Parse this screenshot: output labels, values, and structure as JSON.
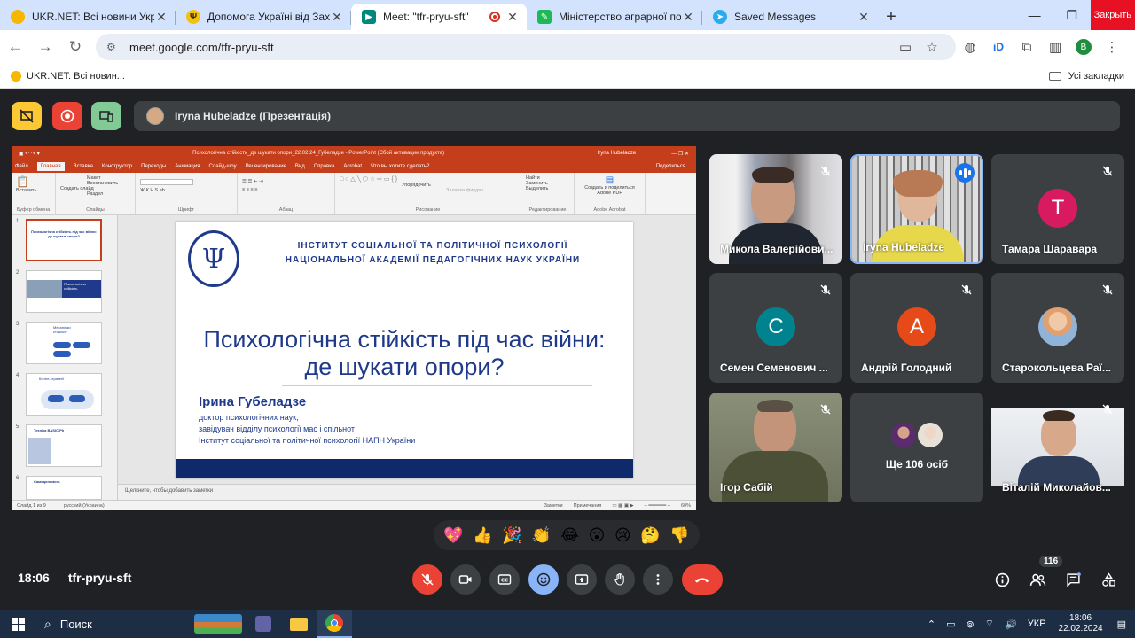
{
  "browser": {
    "tabs": [
      {
        "title": "UKR.NET: Всі новини України, о",
        "favicon_color": "#f5b700",
        "active": false
      },
      {
        "title": "Допомога Україні від Заходу с",
        "favicon_color": "#f4c20d",
        "active": false
      },
      {
        "title": "Meet: \"tfr-pryu-sft\"",
        "favicon_color": "#00897b",
        "active": true,
        "recording": true
      },
      {
        "title": "Міністерство аграрної політи",
        "favicon_color": "#1db954",
        "active": false
      },
      {
        "title": "Saved Messages",
        "favicon_color": "#2aabee",
        "active": false
      }
    ],
    "close_label": "Закрыть",
    "url": "meet.google.com/tfr-pryu-sft",
    "profile_letter": "В",
    "bookmark": "UKR.NET: Всі новин...",
    "all_bookmarks": "Усі закладки"
  },
  "meet": {
    "presenter_label": "Iryna Hubeladze (Презентація)",
    "meeting_time": "18:06",
    "meeting_code": "tfr-pryu-sft",
    "participant_count": "116",
    "participants": [
      {
        "name": "Микола Валерійови...",
        "muted": true,
        "type": "video"
      },
      {
        "name": "Iryna Hubeladze",
        "muted": false,
        "speaking": true,
        "type": "video"
      },
      {
        "name": "Тамара Шаравара",
        "muted": true,
        "type": "avatar",
        "letter": "Т",
        "color": "#d81b60"
      },
      {
        "name": "Семен Семенович ...",
        "muted": true,
        "type": "avatar",
        "letter": "С",
        "color": "#00838f"
      },
      {
        "name": "Андрій Голодний",
        "muted": true,
        "type": "avatar",
        "letter": "А",
        "color": "#e64a19"
      },
      {
        "name": "Старокольцева Раї...",
        "muted": true,
        "type": "photo"
      },
      {
        "name": "Ігор Сабій",
        "muted": true,
        "type": "video"
      },
      {
        "name": "Ще 106 осіб",
        "muted": false,
        "type": "more"
      },
      {
        "name": "Віталій Миколайов...",
        "muted": true,
        "type": "video"
      }
    ],
    "reactions": [
      "💖",
      "👍",
      "🎉",
      "👏",
      "😂",
      "😮",
      "😢",
      "🤔",
      "👎"
    ]
  },
  "powerpoint": {
    "title_bar": "Психологічна стійкість_де шукати опори_22.02.24_Губеладзе  -  PowerPoint (Сбой активации продукта)",
    "user": "Iryna Hubeladze",
    "menu": [
      "Файл",
      "Главная",
      "Вставка",
      "Конструктор",
      "Переходы",
      "Анимация",
      "Слайд-шоу",
      "Рецензирование",
      "Вид",
      "Справка",
      "Acrobat",
      "Что вы хотите сделать?"
    ],
    "share_label": "Поделиться",
    "ribbon_groups": [
      {
        "label": "Буфер обмена",
        "items": [
          "Вставить"
        ]
      },
      {
        "label": "Слайды",
        "items": [
          "Создать слайд",
          "Макет",
          "Восстановить",
          "Раздел"
        ]
      },
      {
        "label": "Шрифт",
        "items": []
      },
      {
        "label": "Абзац",
        "items": []
      },
      {
        "label": "Рисование",
        "items": [
          "Упорядочить",
          "Экспресс-стили",
          "Заливка фигуры",
          "Контур фигуры",
          "Эффекты фигуры"
        ]
      },
      {
        "label": "Редактирование",
        "items": [
          "Найти",
          "Заменить",
          "Выделить"
        ]
      },
      {
        "label": "Adobe Acrobat",
        "items": [
          "Создать и поделиться Adobe PDF"
        ]
      }
    ],
    "slide_numbers": [
      "1",
      "2",
      "3",
      "4",
      "5",
      "6"
    ],
    "thumb_texts": [
      "Психологічна стійкість під час війни: де шукати опори?",
      "Психологічна стійкість",
      "Механізми стійкості",
      "Копінг-стратегії",
      "Техніка BASIC Ph",
      "Самодопомога"
    ],
    "slide": {
      "institute_line1": "ІНСТИТУТ СОЦІАЛЬНОЇ ТА ПОЛІТИЧНОЇ ПСИХОЛОГІЇ",
      "institute_line2": "НАЦІОНАЛЬНОЇ АКАДЕМІЇ ПЕДАГОГІЧНИХ НАУК УКРАЇНИ",
      "title_line1": "Психологічна стійкість під час війни:",
      "title_line2": "де шукати опори?",
      "author": "Ірина Губеладзе",
      "author_line1": "доктор психологічних наук,",
      "author_line2": "завідувач відділу психології мас і спільнот",
      "author_line3": "Інститут соціальної та політичної психології НАПН України"
    },
    "notes_placeholder": "Щелкните, чтобы добавить заметки",
    "status_left": "Слайд 1 из 9",
    "status_lang": "русский (Украина)",
    "status_notes": "Заметки",
    "status_comments": "Примечания",
    "zoom": "60%"
  },
  "taskbar": {
    "search_label": "Поиск",
    "lang": "УКР",
    "time": "18:06",
    "date": "22.02.2024"
  },
  "colors": {
    "meet_bg": "#202124",
    "end_call": "#ea4335",
    "ppt_accent": "#c43e1c",
    "slide_blue": "#1f3a8a"
  }
}
